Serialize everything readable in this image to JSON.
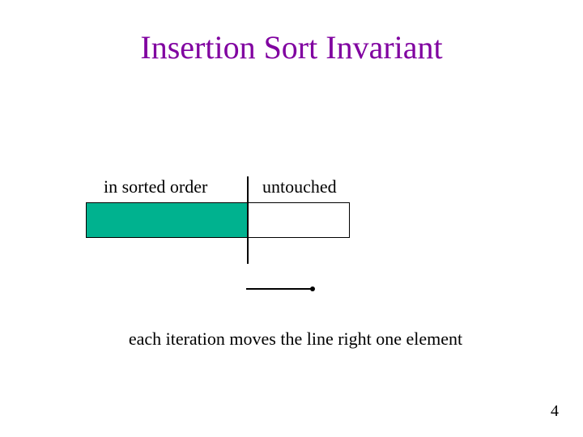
{
  "title": "Insertion Sort Invariant",
  "labels": {
    "sorted": "in sorted order",
    "untouched": "untouched"
  },
  "caption": "each iteration moves the line right one element",
  "page_number": "4",
  "colors": {
    "title": "#8000a0",
    "sorted_fill": "#00b28f"
  }
}
